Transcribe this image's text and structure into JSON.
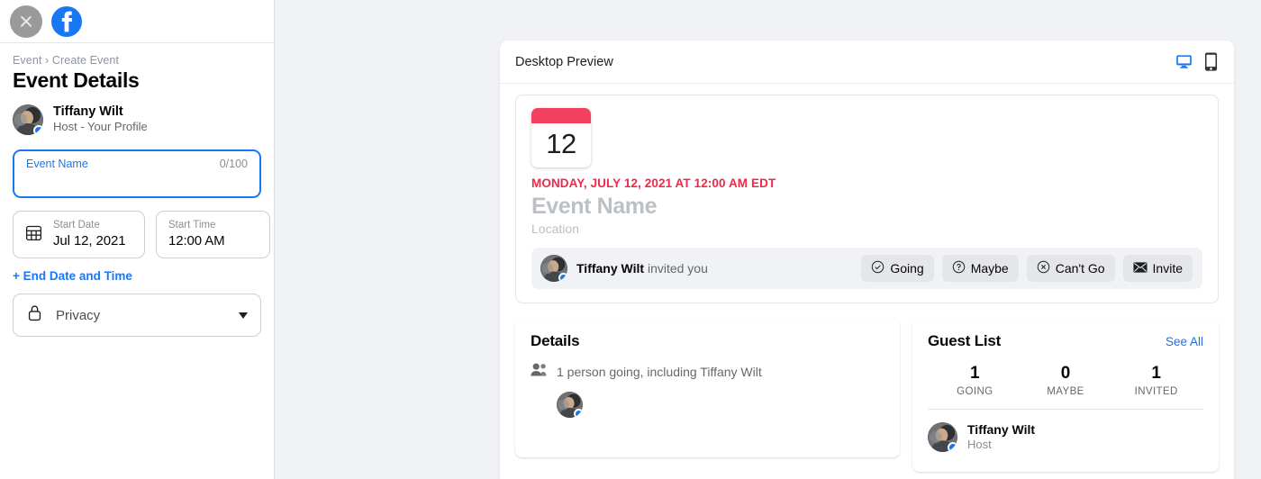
{
  "left_panel": {
    "close_icon": "close-icon",
    "brand_icon": "facebook-logo",
    "breadcrumb": "Event › Create Event",
    "page_title": "Event Details",
    "host": {
      "name": "Tiffany Wilt",
      "subtitle": "Host - Your Profile",
      "avatar_badge_color": "#1877f2"
    },
    "event_name_field": {
      "label": "Event Name",
      "value": "",
      "counter": "0/100",
      "focus_color": "#1877f2"
    },
    "start_date": {
      "icon": "calendar-icon",
      "label": "Start Date",
      "value": "Jul 12, 2021"
    },
    "start_time": {
      "label": "Start Time",
      "value": "12:00 AM"
    },
    "end_datetime_link": "+ End Date and Time",
    "privacy": {
      "icon": "lock-icon",
      "label": "Privacy",
      "chevron": "chevron-down-icon"
    }
  },
  "preview": {
    "header_title": "Desktop Preview",
    "devices": [
      {
        "name": "desktop-icon",
        "active": true,
        "color": "#1877f2"
      },
      {
        "name": "mobile-icon",
        "active": false,
        "color": "#303338"
      }
    ],
    "calendar": {
      "day": "12",
      "top_color": "#f1415e"
    },
    "when": "MONDAY, JULY 12, 2021 AT 12:00 AM EDT",
    "when_color": "#f02849",
    "event_name_placeholder": "Event Name",
    "location_placeholder": "Location",
    "rsvp": {
      "invited_by": "Tiffany Wilt",
      "invited_text": " invited you",
      "buttons": [
        {
          "label": "Going",
          "icon": "check-circle-icon"
        },
        {
          "label": "Maybe",
          "icon": "question-circle-icon"
        },
        {
          "label": "Can't Go",
          "icon": "x-circle-icon"
        },
        {
          "label": "Invite",
          "icon": "envelope-icon"
        }
      ]
    },
    "details": {
      "title": "Details",
      "going_icon": "people-icon",
      "going_text": "1 person going, including Tiffany Wilt"
    },
    "guest_list": {
      "title": "Guest List",
      "see_all": "See All",
      "stats": [
        {
          "number": "1",
          "label": "GOING"
        },
        {
          "number": "0",
          "label": "MAYBE"
        },
        {
          "number": "1",
          "label": "INVITED"
        }
      ],
      "guests": [
        {
          "name": "Tiffany Wilt",
          "role": "Host"
        }
      ]
    }
  }
}
